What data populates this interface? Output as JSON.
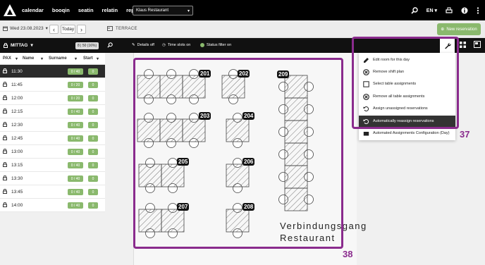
{
  "nav": {
    "links": [
      "calendar",
      "booqin",
      "seatin",
      "relatin",
      "reportin"
    ],
    "restaurant": "Klaus Restaurant",
    "language": "EN"
  },
  "toolbar": {
    "date": "Wed 23.08.2023",
    "today_label": "Today",
    "area": "TERRACE",
    "new_reservation_label": "New reservation"
  },
  "filterbar": {
    "shift": "MITTAG",
    "capacity": "8 | 50 (16%)",
    "details_label": "Details off",
    "timeslots_label": "Time slots on",
    "statusfilter_label": "Status filter on"
  },
  "list": {
    "headers": [
      "PAX",
      "Name",
      "Surname",
      "Start"
    ],
    "rows": [
      {
        "time": "11:30",
        "cap": "0 / 40",
        "count": "0"
      },
      {
        "time": "11:45",
        "cap": "0 / 20",
        "count": "0"
      },
      {
        "time": "12:00",
        "cap": "0 / 20",
        "count": "0"
      },
      {
        "time": "12:15",
        "cap": "0 / 40",
        "count": "0"
      },
      {
        "time": "12:30",
        "cap": "0 / 40",
        "count": "0"
      },
      {
        "time": "12:45",
        "cap": "0 / 40",
        "count": "0"
      },
      {
        "time": "13:00",
        "cap": "0 / 40",
        "count": "0"
      },
      {
        "time": "13:15",
        "cap": "0 / 40",
        "count": "0"
      },
      {
        "time": "13:30",
        "cap": "0 / 40",
        "count": "0"
      },
      {
        "time": "13:45",
        "cap": "0 / 40",
        "count": "0"
      },
      {
        "time": "14:00",
        "cap": "0 / 40",
        "count": "0"
      }
    ]
  },
  "tables": [
    "201",
    "202",
    "203",
    "204",
    "205",
    "206",
    "207",
    "208",
    "209"
  ],
  "room_label": {
    "line1": "Verbindungsgang",
    "line2": "Restaurant"
  },
  "menu": {
    "items": [
      "Edit room for this day",
      "Remove shift plan",
      "Select table assignments",
      "Remove all table assignments",
      "Assign unassigned reservations",
      "Automatically reassign reservations",
      "Automated Assignments Configuration (Day)"
    ],
    "active_index": 5
  },
  "annotations": {
    "menu_callout": "37",
    "room_callout": "38"
  },
  "colors": {
    "accent": "#8ab96d",
    "callout": "#8a2b8d",
    "topbar": "#000000"
  }
}
